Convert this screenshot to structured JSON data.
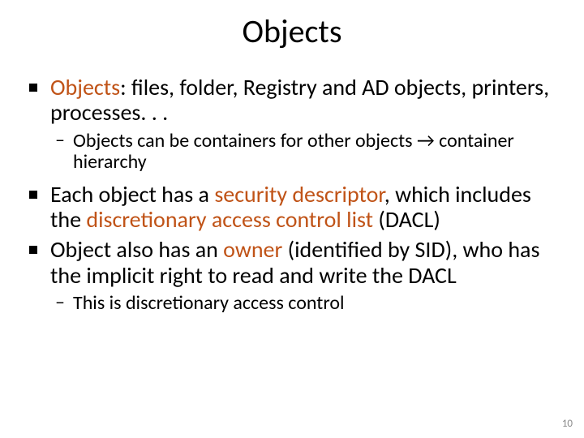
{
  "title": "Objects",
  "bullets": {
    "b1": {
      "t1": "Objects",
      "t2": ": files, folder, Registry and AD objects, printers, processes. . .",
      "sub": {
        "t1": "Objects can be containers for other objects ",
        "t2": "→",
        "t3": " container hierarchy"
      }
    },
    "b2": {
      "t1": "Each object has a ",
      "t2": "security descriptor",
      "t3": ", which includes the ",
      "t4": "discretionary access control list",
      "t5": " (DACL)"
    },
    "b3": {
      "t1": "Object also has an ",
      "t2": "owner",
      "t3": " (identified by SID), who has the implicit right to read and write the DACL",
      "sub": {
        "t1": "This is discretionary access control"
      }
    }
  },
  "page_number": "10"
}
